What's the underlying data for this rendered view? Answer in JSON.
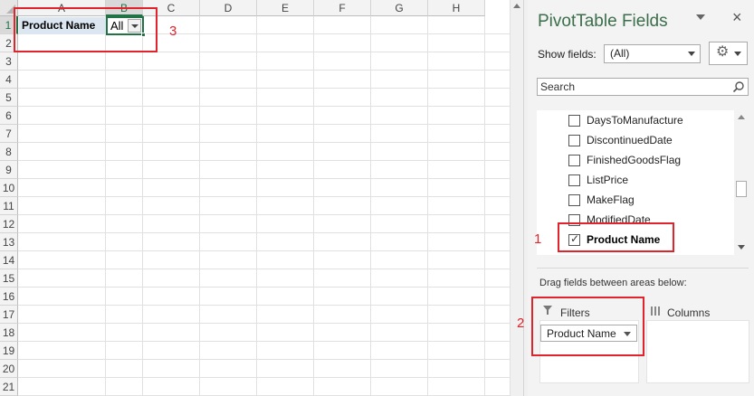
{
  "sheet": {
    "columns": [
      "A",
      "B",
      "C",
      "D",
      "E",
      "F",
      "G",
      "H"
    ],
    "rows": [
      "1",
      "2",
      "3",
      "4",
      "5",
      "6",
      "7",
      "8",
      "9",
      "10",
      "11",
      "12",
      "13",
      "14",
      "15",
      "16",
      "17",
      "18",
      "19",
      "20",
      "21"
    ],
    "cells": {
      "a1": "Product Name",
      "b1": "All"
    }
  },
  "annotations": {
    "n1": "1",
    "n2": "2",
    "n3": "3",
    "color": "#e0242c"
  },
  "pane": {
    "title": "PivotTable Fields",
    "show_fields_label": "Show fields:",
    "show_fields_value": "(All)",
    "search_placeholder": "Search",
    "fields": [
      {
        "label": "DaysToManufacture",
        "checked": false
      },
      {
        "label": "DiscontinuedDate",
        "checked": false
      },
      {
        "label": "FinishedGoodsFlag",
        "checked": false
      },
      {
        "label": "ListPrice",
        "checked": false
      },
      {
        "label": "MakeFlag",
        "checked": false
      },
      {
        "label": "ModifiedDate",
        "checked": false
      },
      {
        "label": "Product Name",
        "checked": true
      }
    ],
    "drag_label": "Drag fields between areas below:",
    "areas": {
      "filters": "Filters",
      "columns": "Columns",
      "filters_items": [
        "Product Name"
      ]
    }
  },
  "colors": {
    "accent_green": "#217346",
    "title_green": "#3b6e4a",
    "header_fill": "#dce6f1"
  }
}
